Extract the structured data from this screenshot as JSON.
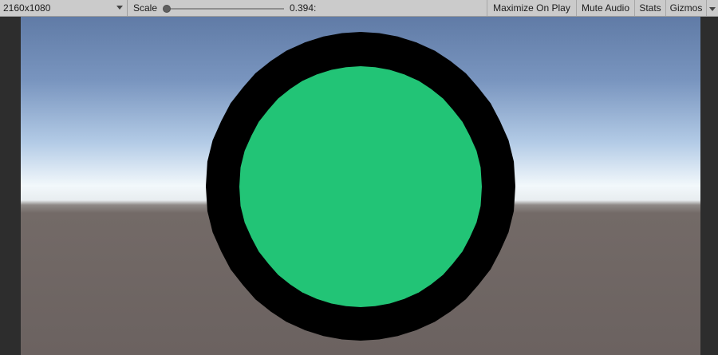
{
  "toolbar": {
    "resolution": "2160x1080",
    "resolution_icon": "chevron-down-icon",
    "scale_label": "Scale",
    "scale_value_text": "0.394:",
    "scale_value": 0.394,
    "buttons": {
      "maximize_on_play": "Maximize On Play",
      "mute_audio": "Mute Audio",
      "stats": "Stats",
      "gizmos": "Gizmos"
    },
    "gizmos_menu_icon": "chevron-down-icon"
  },
  "scene": {
    "outer_ring_color": "#000000",
    "center_color": "#22c476",
    "sky_top_color": "#607ba6",
    "horizon_color": "#f2f8fb",
    "ground_color": "#6b6260"
  }
}
